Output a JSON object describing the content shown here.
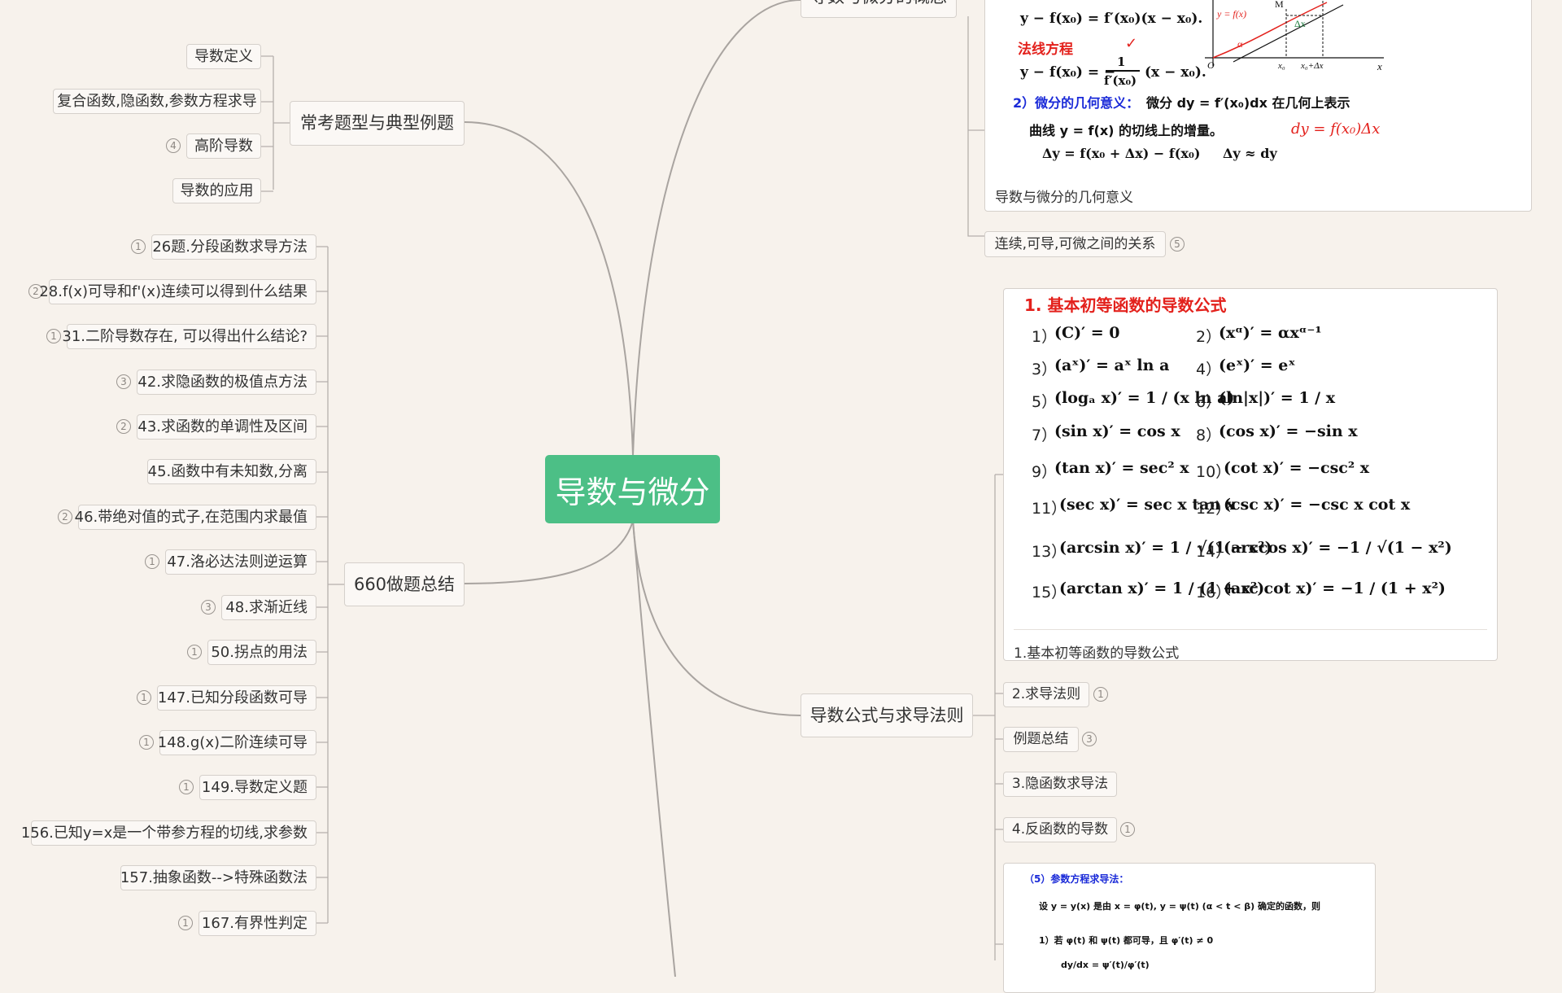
{
  "root": {
    "label": "导数与微分"
  },
  "branches": {
    "changkao": {
      "label": "常考题型与典型例题"
    },
    "q660": {
      "label": "660做题总结"
    },
    "formula": {
      "label": "导数公式与求导法则"
    },
    "concept": {
      "label": "导数与微分的概念"
    }
  },
  "changkao_items": [
    {
      "label": "导数定义"
    },
    {
      "label": "复合函数,隐函数,参数方程求导"
    },
    {
      "label": "高阶导数",
      "badge": "4"
    },
    {
      "label": "导数的应用"
    }
  ],
  "q660_items": [
    {
      "label": "26题.分段函数求导方法",
      "badge": "1"
    },
    {
      "label": "28.f(x)可导和f'(x)连续可以得到什么结果",
      "badge": "2"
    },
    {
      "label": "31.二阶导数存在, 可以得出什么结论?",
      "badge": "1"
    },
    {
      "label": "42.求隐函数的极值点方法",
      "badge": "3"
    },
    {
      "label": "43.求函数的单调性及区间",
      "badge": "2"
    },
    {
      "label": "45.函数中有未知数,分离"
    },
    {
      "label": "46.带绝对值的式子,在范围内求最值",
      "badge": "2"
    },
    {
      "label": "47.洛必达法则逆运算",
      "badge": "1"
    },
    {
      "label": "48.求渐近线",
      "badge": "3"
    },
    {
      "label": "50.拐点的用法",
      "badge": "1"
    },
    {
      "label": "147.已知分段函数可导",
      "badge": "1"
    },
    {
      "label": "148.g(x)二阶连续可导",
      "badge": "1"
    },
    {
      "label": "149.导数定义题",
      "badge": "1"
    },
    {
      "label": "156.已知y=x是一个带参方程的切线,求参数"
    },
    {
      "label": "157.抽象函数-->特殊函数法"
    },
    {
      "label": "167.有界性判定",
      "badge": "1"
    }
  ],
  "concept_items": {
    "card_caption": "导数与微分的几何意义",
    "tangent_eq": "y − f(x₀) = f′(x₀)(x − x₀).",
    "normal_label": "法线方程",
    "normal_eq_lhs": "y − f(x₀) = −",
    "normal_eq_den": "f′(x₀)",
    "normal_eq_rhs": "(x − x₀).",
    "diff_geo_title": "2）微分的几何意义：",
    "diff_geo_text": "微分 dy = f′(x₀)dx 在几何上表示",
    "diff_geo_text2": "曲线 y = f(x) 的切线上的增量。",
    "delta_y": "Δy = f(x₀ + Δx) − f(x₀)",
    "approx": "Δy ≈ dy",
    "hand_note": "dy = f(x₀)Δx",
    "continuity": {
      "label": "连续,可导,可微之间的关系",
      "badge": "5"
    }
  },
  "formula_items": {
    "card_title": "1. 基本初等函数的导数公式",
    "card_caption": "1.基本初等函数的导数公式",
    "formulas": [
      {
        "n": "1）",
        "f": "(C)′ = 0"
      },
      {
        "n": "2）",
        "f": "(xᵅ)′ = αxᵅ⁻¹"
      },
      {
        "n": "3）",
        "f": "(aˣ)′ = aˣ ln a"
      },
      {
        "n": "4）",
        "f": "(eˣ)′ = eˣ"
      },
      {
        "n": "5）",
        "f": "(logₐ x)′ = 1 / (x ln a)"
      },
      {
        "n": "6）",
        "f": "(ln|x|)′ = 1 / x"
      },
      {
        "n": "7）",
        "f": "(sin x)′ = cos x"
      },
      {
        "n": "8）",
        "f": "(cos x)′ = −sin x"
      },
      {
        "n": "9）",
        "f": "(tan x)′ = sec² x"
      },
      {
        "n": "10）",
        "f": "(cot x)′ = −csc² x"
      },
      {
        "n": "11）",
        "f": "(sec x)′ = sec x tan x"
      },
      {
        "n": "12）",
        "f": "(csc x)′ = −csc x cot x"
      },
      {
        "n": "13）",
        "f": "(arcsin x)′ = 1 / √(1 − x²)"
      },
      {
        "n": "14）",
        "f": "(arccos x)′ = −1 / √(1 − x²)"
      },
      {
        "n": "15）",
        "f": "(arctan x)′ = 1 / (1 + x²)"
      },
      {
        "n": "16）",
        "f": "(arc cot x)′ = −1 / (1 + x²)"
      }
    ],
    "children": [
      {
        "label": "2.求导法则",
        "badge": "1"
      },
      {
        "label": "例题总结",
        "badge": "3"
      },
      {
        "label": "3.隐函数求导法"
      },
      {
        "label": "4.反函数的导数",
        "badge": "1"
      }
    ],
    "param_card": {
      "title": "（5）参数方程求导法：",
      "line1": "设 y = y(x) 是由 x = φ(t), y = ψ(t) (α < t < β) 确定的函数，则",
      "line2": "1）若 φ(t) 和 ψ(t) 都可导，且 φ′(t) ≠ 0",
      "line3": "dy/dx = ψ′(t)/φ′(t)"
    }
  }
}
